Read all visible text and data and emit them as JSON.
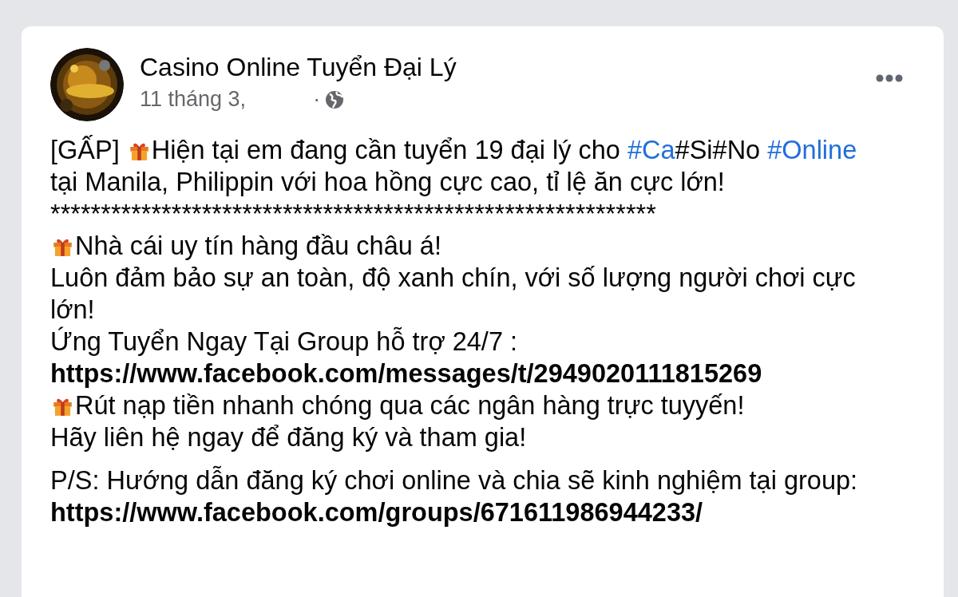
{
  "post": {
    "author": "Casino Online Tuyển Đại Lý",
    "date": "11 tháng 3,",
    "separator": "·",
    "paragraphs": [
      {
        "lines": [
          {
            "kind": "text",
            "parts": [
              {
                "kind": "text",
                "text": "[GẤP] "
              },
              {
                "kind": "gift"
              },
              {
                "kind": "text",
                "text": "Hiện tại em đang cần tuyển 19 đại lý cho "
              },
              {
                "kind": "hashtag",
                "text": "#Ca"
              },
              {
                "kind": "text",
                "text": "#Si#No "
              },
              {
                "kind": "hashtag",
                "text": "#Online"
              }
            ]
          },
          {
            "kind": "text",
            "parts": [
              {
                "kind": "text",
                "text": "tại Manila, Philippin với hoa hồng cực cao, tỉ lệ ăn cực lớn!"
              }
            ]
          },
          {
            "kind": "text",
            "parts": [
              {
                "kind": "text",
                "text": "************************************************************"
              }
            ]
          },
          {
            "kind": "text",
            "parts": [
              {
                "kind": "gift"
              },
              {
                "kind": "text",
                "text": "Nhà cái uy tín hàng đầu châu á!"
              }
            ]
          },
          {
            "kind": "text",
            "parts": [
              {
                "kind": "text",
                "text": "Luôn đảm bảo sự an toàn, độ xanh chín, với số lượng người chơi cực"
              }
            ]
          },
          {
            "kind": "text",
            "parts": [
              {
                "kind": "text",
                "text": "lớn!"
              }
            ]
          },
          {
            "kind": "text",
            "parts": [
              {
                "kind": "text",
                "text": "Ứng Tuyển Ngay Tại Group hỗ trợ 24/7 :"
              }
            ]
          },
          {
            "kind": "link",
            "text": "https://www.facebook.com/messages/t/2949020111815269"
          },
          {
            "kind": "text",
            "parts": [
              {
                "kind": "gift"
              },
              {
                "kind": "text",
                "text": "Rút nạp tiền nhanh chóng qua các ngân hàng trực tuyyến!"
              }
            ]
          },
          {
            "kind": "text",
            "parts": [
              {
                "kind": "text",
                "text": "Hãy liên hệ ngay để đăng ký và tham gia!"
              }
            ]
          }
        ]
      },
      {
        "lines": [
          {
            "kind": "text",
            "parts": [
              {
                "kind": "text",
                "text": "P/S: Hướng dẫn đăng ký chơi online và chia sẽ kinh nghiệm tại group:"
              }
            ]
          },
          {
            "kind": "link",
            "text": "https://www.facebook.com/groups/671611986944233/"
          }
        ]
      }
    ]
  }
}
